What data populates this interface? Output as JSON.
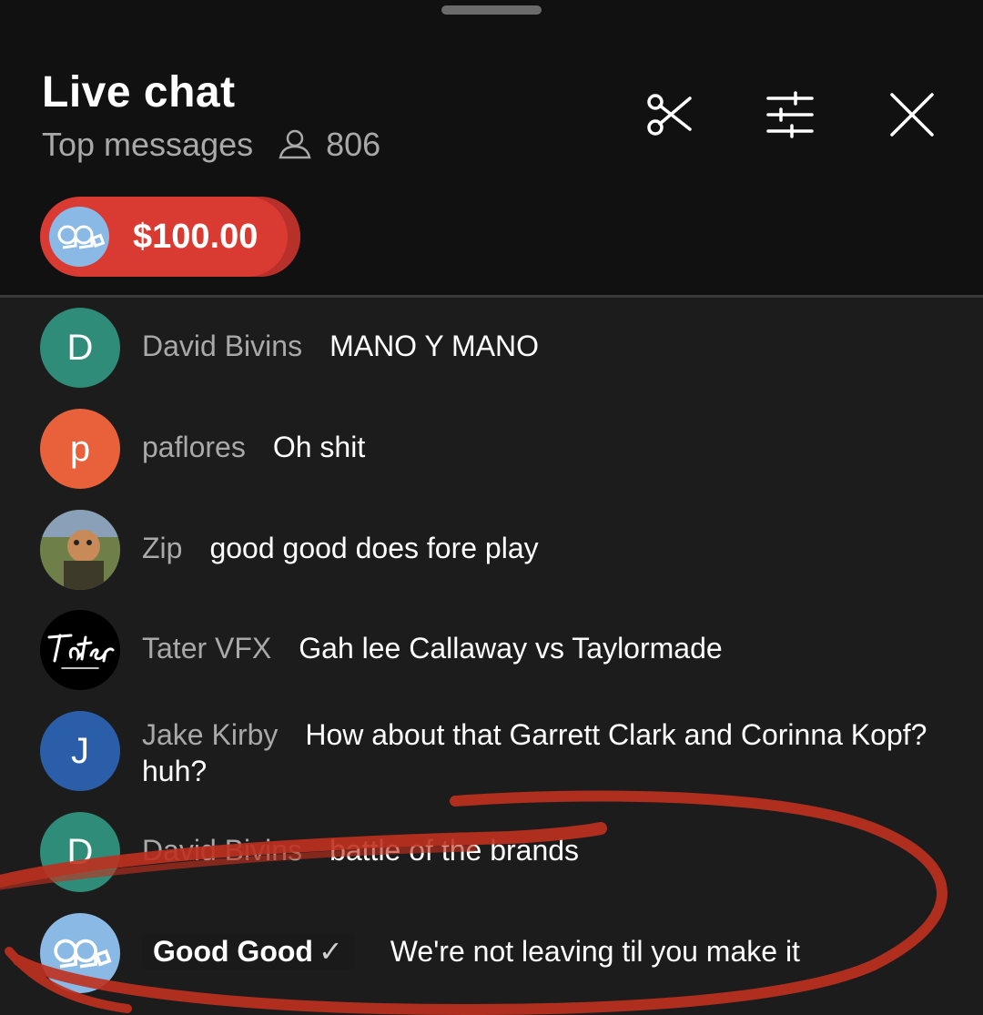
{
  "header": {
    "title": "Live chat",
    "mode": "Top messages",
    "viewer_count": "806",
    "icons": [
      "scissors-icon",
      "filter-sliders-icon",
      "close-icon",
      "person-icon"
    ]
  },
  "super_chat": {
    "amount": "$100.00",
    "color": "#d93a31"
  },
  "messages": [
    {
      "author": "David Bivins",
      "text": "MANO Y MANO",
      "initial": "D",
      "avatar_color": "#2f8c78"
    },
    {
      "author": "paflores",
      "text": "Oh shit",
      "initial": "p",
      "avatar_color": "#e8613a"
    },
    {
      "author": "Zip",
      "text": "good good does fore play",
      "avatar_color": "#5b6a3e"
    },
    {
      "author": "Tater VFX",
      "text": "Gah lee Callaway vs Taylormade",
      "avatar_color": "#000000"
    },
    {
      "author": "Jake Kirby",
      "text": "How about that Garrett Clark and Corinna Kopf? huh?",
      "initial": "J",
      "avatar_color": "#2a5ea8"
    },
    {
      "author": "David Bivins",
      "text": "battle of the brands",
      "initial": "D",
      "avatar_color": "#2f8c78"
    },
    {
      "author": "Good Good",
      "text": "We're not leaving til you make it",
      "verified": true,
      "avatar_color": "#8bb9e6"
    }
  ],
  "annotation_color": "#c0301f"
}
